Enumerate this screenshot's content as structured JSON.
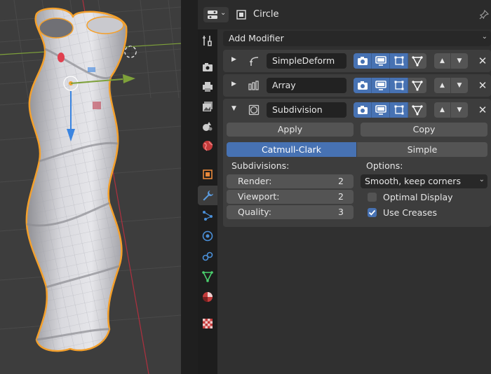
{
  "header": {
    "object_name": "Circle",
    "editor_type_icon": "properties-editor-icon",
    "object_icon": "object-data-icon",
    "pin_icon": "pin-icon"
  },
  "add_modifier": {
    "label": "Add Modifier"
  },
  "tabs": [
    {
      "name": "tool-tab",
      "icon": "tool-icon",
      "active": false
    },
    {
      "name": "render-tab",
      "icon": "camera-back-icon",
      "active": false
    },
    {
      "name": "output-tab",
      "icon": "printer-icon",
      "active": false
    },
    {
      "name": "view-layer-tab",
      "icon": "image-stack-icon",
      "active": false
    },
    {
      "name": "scene-tab",
      "icon": "scene-icon",
      "active": false
    },
    {
      "name": "world-tab",
      "icon": "world-icon",
      "active": false
    },
    {
      "name": "object-tab",
      "icon": "object-square-icon",
      "active": false
    },
    {
      "name": "modifiers-tab",
      "icon": "wrench-icon",
      "active": true
    },
    {
      "name": "particles-tab",
      "icon": "particles-icon",
      "active": false
    },
    {
      "name": "physics-tab",
      "icon": "physics-icon",
      "active": false
    },
    {
      "name": "constraints-tab",
      "icon": "constraint-icon",
      "active": false
    },
    {
      "name": "data-tab",
      "icon": "mesh-data-icon",
      "active": false
    },
    {
      "name": "material-tab",
      "icon": "material-sphere-icon",
      "active": false
    },
    {
      "name": "texture-tab",
      "icon": "checker-texture-icon",
      "active": false
    }
  ],
  "modifiers": [
    {
      "name": "SimpleDeform",
      "expanded": false,
      "icon": "simple-deform-icon"
    },
    {
      "name": "Array",
      "expanded": false,
      "icon": "array-icon"
    },
    {
      "name": "Subdivision",
      "expanded": true,
      "icon": "subdivision-icon"
    }
  ],
  "subdivision": {
    "apply_label": "Apply",
    "copy_label": "Copy",
    "type_options": [
      "Catmull-Clark",
      "Simple"
    ],
    "type_selected": "Catmull-Clark",
    "subdivisions_label": "Subdivisions:",
    "options_label": "Options:",
    "render_label": "Render:",
    "render_value": "2",
    "viewport_label": "Viewport:",
    "viewport_value": "2",
    "quality_label": "Quality:",
    "quality_value": "3",
    "uv_smooth": "Smooth, keep corners",
    "optimal_display_label": "Optimal Display",
    "optimal_display": false,
    "use_creases_label": "Use Creases",
    "use_creases": true
  },
  "colors": {
    "accent": "#4772b3",
    "selection_outline": "#f5a02a",
    "panel": "#3d3d3d"
  }
}
